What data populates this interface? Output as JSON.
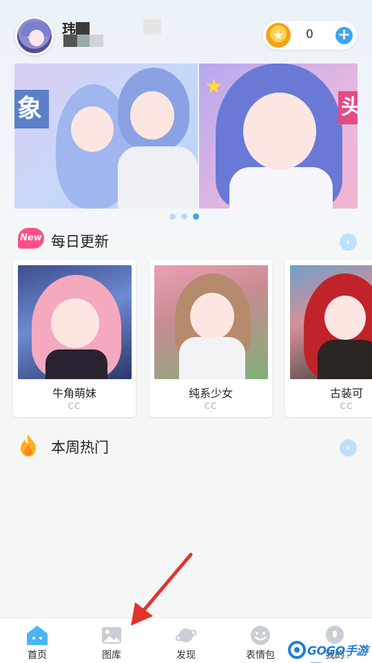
{
  "header": {
    "username": "玮",
    "coins": "0",
    "add_symbol": "+"
  },
  "banner": {
    "slide1_tag": "象",
    "slide2_tag": "头",
    "dots": 3,
    "active_dot": 2
  },
  "daily": {
    "badge": "New",
    "title": "每日更新",
    "more": "›"
  },
  "cards": [
    {
      "title": "牛角萌妹",
      "author": "CC"
    },
    {
      "title": "纯系少女",
      "author": "CC"
    },
    {
      "title": "古装可",
      "author": "CC"
    }
  ],
  "weekly": {
    "title": "本周热门",
    "more": "›"
  },
  "nav": [
    {
      "label": "首页",
      "icon": "home-icon"
    },
    {
      "label": "图库",
      "icon": "gallery-icon"
    },
    {
      "label": "发现",
      "icon": "planet-icon"
    },
    {
      "label": "表情包",
      "icon": "smiley-icon"
    },
    {
      "label": "我的",
      "icon": "profile-icon"
    }
  ],
  "watermark": {
    "text": "GOGO手游网",
    "sub": "GOGO.CN"
  },
  "colors": {
    "accent": "#3fa3f2",
    "new_badge": "#ff4f86",
    "arrow": "#e0342c"
  }
}
